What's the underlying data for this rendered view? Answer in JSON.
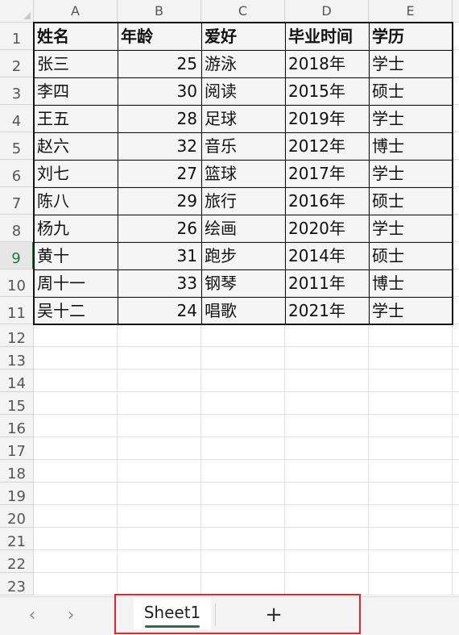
{
  "columns": [
    "A",
    "B",
    "C",
    "D",
    "E"
  ],
  "rows": [
    "1",
    "2",
    "3",
    "4",
    "5",
    "6",
    "7",
    "8",
    "9",
    "10",
    "11",
    "12",
    "13",
    "14",
    "15",
    "16",
    "17",
    "18",
    "19",
    "20",
    "21",
    "22",
    "23"
  ],
  "selected_row": "9",
  "table": {
    "header": [
      "姓名",
      "年龄",
      "爱好",
      "毕业时间",
      "学历"
    ],
    "data": [
      [
        "张三",
        "25",
        "游泳",
        "2018年",
        "学士"
      ],
      [
        "李四",
        "30",
        "阅读",
        "2015年",
        "硕士"
      ],
      [
        "王五",
        "28",
        "足球",
        "2019年",
        "学士"
      ],
      [
        "赵六",
        "32",
        "音乐",
        "2012年",
        "博士"
      ],
      [
        "刘七",
        "27",
        "篮球",
        "2017年",
        "学士"
      ],
      [
        "陈八",
        "29",
        "旅行",
        "2016年",
        "硕士"
      ],
      [
        "杨九",
        "26",
        "绘画",
        "2020年",
        "学士"
      ],
      [
        "黄十",
        "31",
        "跑步",
        "2014年",
        "硕士"
      ],
      [
        "周十一",
        "33",
        "钢琴",
        "2011年",
        "博士"
      ],
      [
        "吴十二",
        "24",
        "唱歌",
        "2021年",
        "学士"
      ]
    ]
  },
  "tabs": {
    "sheet_name": "Sheet1",
    "prev_glyph": "‹",
    "next_glyph": "›",
    "add_glyph": "+"
  }
}
